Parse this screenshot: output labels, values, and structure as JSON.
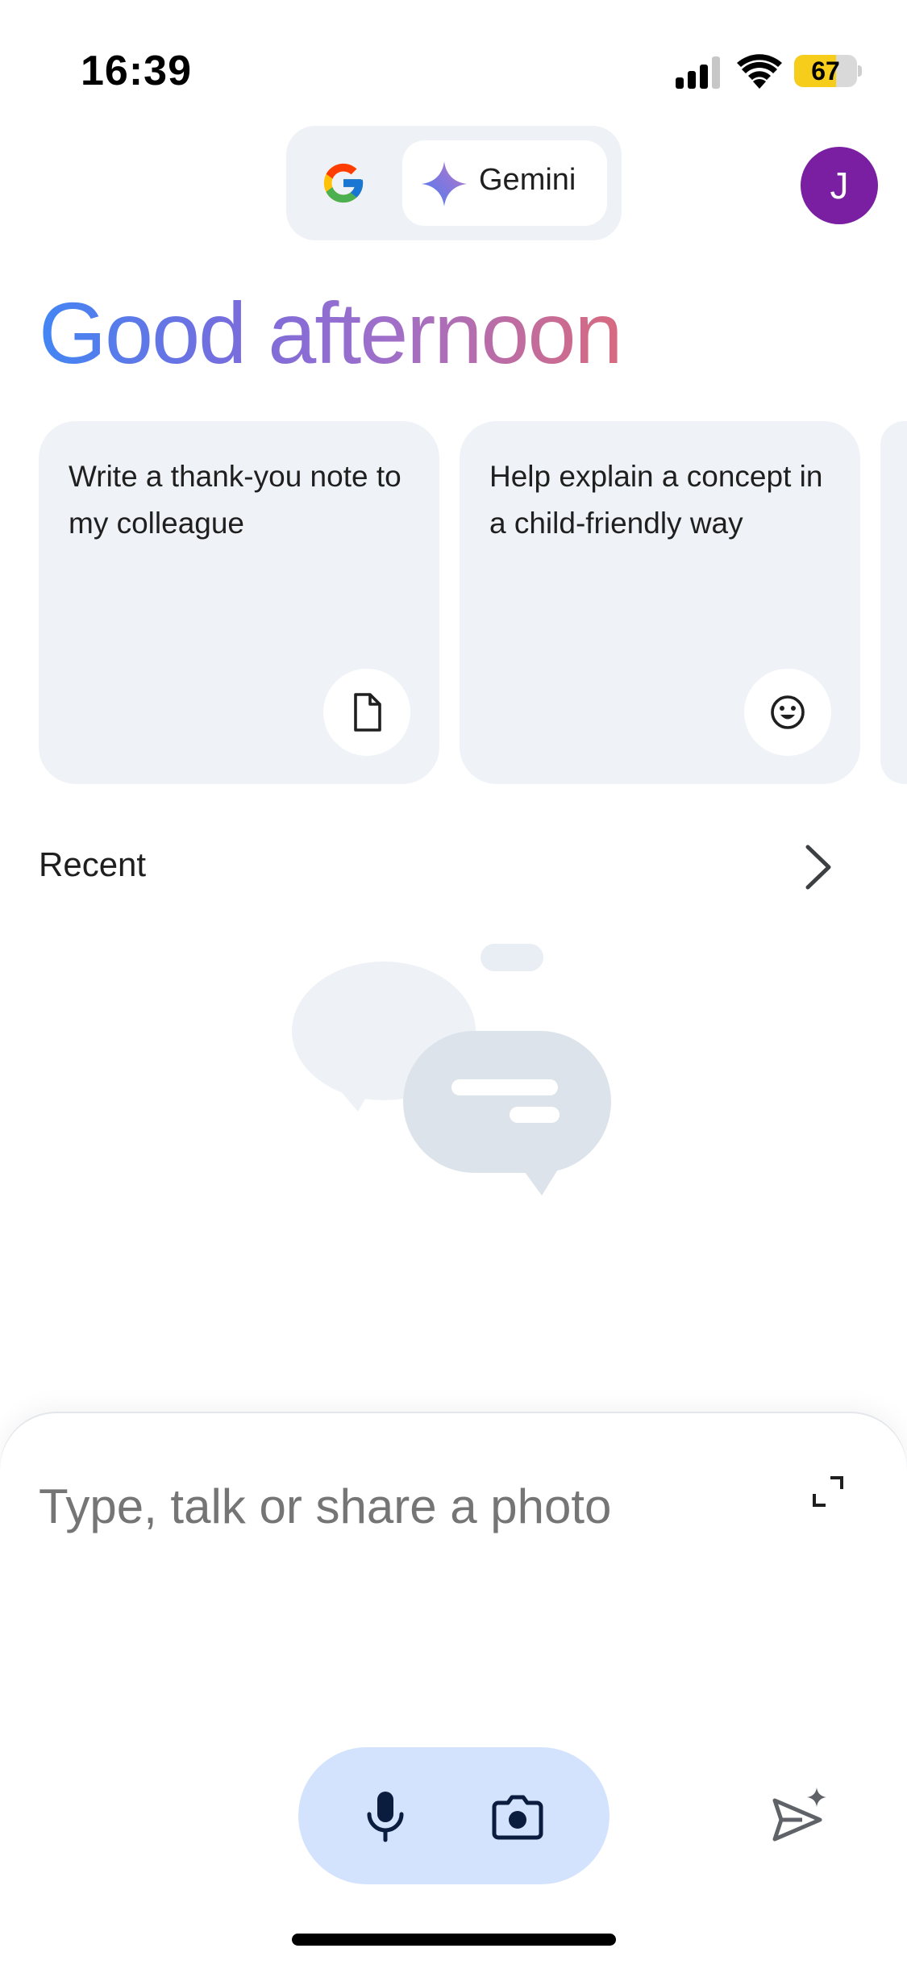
{
  "status_bar": {
    "time": "16:39",
    "battery_level": "67",
    "battery_fraction": 0.67,
    "icons": [
      "cellular-signal-icon",
      "wifi-icon",
      "battery-icon"
    ]
  },
  "switcher": {
    "google_icon": "google-g-icon",
    "gemini_label": "Gemini",
    "gemini_icon": "gemini-sparkle-icon"
  },
  "avatar": {
    "initial": "J",
    "color": "#7b1fa2"
  },
  "greeting": "Good afternoon",
  "cards": [
    {
      "text": "Write a thank-you note to my colleague",
      "icon": "document-icon"
    },
    {
      "text": "Help explain a concept in a child-friendly way",
      "icon": "smiley-icon"
    }
  ],
  "recent": {
    "title": "Recent",
    "icon": "chevron-right-icon"
  },
  "composer": {
    "placeholder": "Type, talk or share a photo",
    "expand_icon": "expand-icon",
    "mic_icon": "microphone-icon",
    "camera_icon": "camera-icon",
    "send_icon": "send-sparkle-icon"
  },
  "colors": {
    "accent_pill": "#d3e3fd",
    "card_bg": "#eff3f7",
    "greeting_gradient": [
      "#4285f4",
      "#a06fc9",
      "#d86a7f"
    ]
  }
}
